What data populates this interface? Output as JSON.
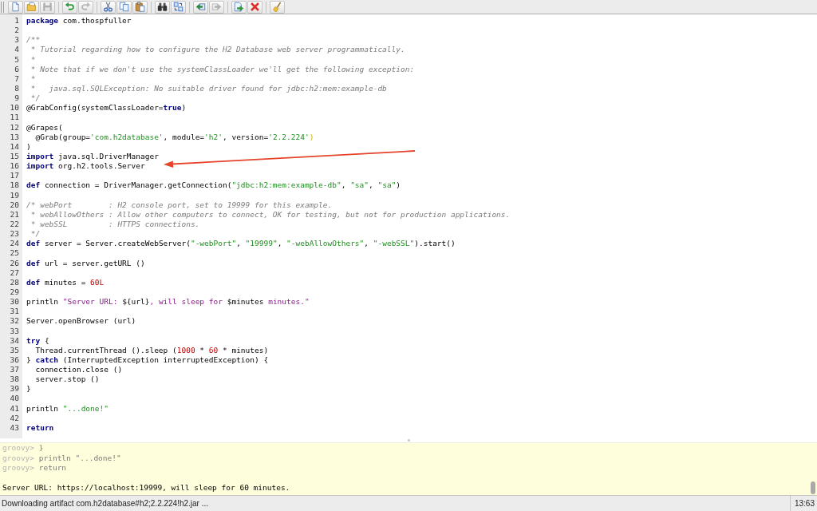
{
  "toolbar": {
    "groups": [
      {
        "buttons": [
          {
            "disabled": false
          },
          {
            "disabled": false
          },
          {
            "disabled": true
          }
        ]
      },
      {
        "buttons": [
          {
            "disabled": false
          },
          {
            "disabled": true
          }
        ]
      },
      {
        "buttons": [
          {
            "disabled": false
          },
          {
            "disabled": false
          },
          {
            "disabled": false
          }
        ]
      },
      {
        "buttons": [
          {
            "disabled": false
          },
          {
            "disabled": false
          }
        ]
      },
      {
        "buttons": [
          {
            "disabled": false
          },
          {
            "disabled": true
          }
        ]
      },
      {
        "buttons": [
          {
            "disabled": false
          },
          {
            "disabled": false
          }
        ]
      },
      {
        "buttons": [
          {
            "disabled": false
          }
        ]
      }
    ]
  },
  "editor": {
    "lines": [
      {
        "number": "1",
        "tokens": [
          {
            "kind": "keyword",
            "text": "package"
          },
          {
            "kind": "plain",
            "text": " com.thospfuller"
          }
        ]
      },
      {
        "number": "2"
      },
      {
        "number": "3",
        "tokens": [
          {
            "kind": "comment",
            "text": "/**"
          }
        ]
      },
      {
        "number": "4",
        "tokens": [
          {
            "kind": "comment",
            "text": " * Tutorial regarding how to configure the H2 Database web server programmatically."
          }
        ]
      },
      {
        "number": "5",
        "tokens": [
          {
            "kind": "comment",
            "text": " *"
          }
        ]
      },
      {
        "number": "6",
        "tokens": [
          {
            "kind": "comment",
            "text": " * Note that if we don't use the systemClassLoader we'll get the following exception:"
          }
        ]
      },
      {
        "number": "7",
        "tokens": [
          {
            "kind": "comment",
            "text": " *"
          }
        ]
      },
      {
        "number": "8",
        "tokens": [
          {
            "kind": "comment",
            "text": " *   java.sql.SQLException: No suitable driver found for jdbc:h2:mem:example-db"
          }
        ]
      },
      {
        "number": "9",
        "tokens": [
          {
            "kind": "comment",
            "text": " */"
          }
        ]
      },
      {
        "number": "10",
        "tokens": [
          {
            "kind": "plain",
            "text": "@GrabConfig(systemClassLoader="
          },
          {
            "kind": "keyword",
            "text": "true"
          },
          {
            "kind": "plain",
            "text": ")"
          }
        ]
      },
      {
        "number": "11"
      },
      {
        "number": "12",
        "tokens": [
          {
            "kind": "plain",
            "text": "@Grapes("
          }
        ]
      },
      {
        "number": "13",
        "tokens": [
          {
            "kind": "plain",
            "text": "  @Grab(group="
          },
          {
            "kind": "string",
            "text": "'com.h2database'"
          },
          {
            "kind": "plain",
            "text": ", module="
          },
          {
            "kind": "string",
            "text": "'h2'"
          },
          {
            "kind": "plain",
            "text": ", version="
          },
          {
            "kind": "string",
            "text": "'2.2.224'"
          },
          {
            "kind": "matched-bracket",
            "text": ")"
          }
        ]
      },
      {
        "number": "14",
        "tokens": [
          {
            "kind": "plain",
            "text": ")"
          }
        ]
      },
      {
        "number": "15",
        "tokens": [
          {
            "kind": "keyword",
            "text": "import"
          },
          {
            "kind": "plain",
            "text": " java.sql.DriverManager"
          }
        ]
      },
      {
        "number": "16",
        "tokens": [
          {
            "kind": "keyword",
            "text": "import"
          },
          {
            "kind": "plain",
            "text": " org.h2.tools.Server"
          }
        ]
      },
      {
        "number": "17"
      },
      {
        "number": "18",
        "tokens": [
          {
            "kind": "keyword",
            "text": "def"
          },
          {
            "kind": "plain",
            "text": " connection = DriverManager.getConnection("
          },
          {
            "kind": "string",
            "text": "\"jdbc:h2:mem:example-db\""
          },
          {
            "kind": "plain",
            "text": ", "
          },
          {
            "kind": "string",
            "text": "\"sa\""
          },
          {
            "kind": "plain",
            "text": ", "
          },
          {
            "kind": "string",
            "text": "\"sa\""
          },
          {
            "kind": "plain",
            "text": ")"
          }
        ]
      },
      {
        "number": "19"
      },
      {
        "number": "20",
        "tokens": [
          {
            "kind": "comment",
            "text": "/* webPort        : H2 console port, set to 19999 for this example."
          }
        ]
      },
      {
        "number": "21",
        "tokens": [
          {
            "kind": "comment",
            "text": " * webAllowOthers : Allow other computers to connect, OK for testing, but not for production applications."
          }
        ]
      },
      {
        "number": "22",
        "tokens": [
          {
            "kind": "comment",
            "text": " * webSSL         : HTTPS connections."
          }
        ]
      },
      {
        "number": "23",
        "tokens": [
          {
            "kind": "comment",
            "text": " */"
          }
        ]
      },
      {
        "number": "24",
        "tokens": [
          {
            "kind": "keyword",
            "text": "def"
          },
          {
            "kind": "plain",
            "text": " server = Server.createWebServer("
          },
          {
            "kind": "string",
            "text": "\"-webPort\""
          },
          {
            "kind": "plain",
            "text": ", "
          },
          {
            "kind": "string",
            "text": "\"19999\""
          },
          {
            "kind": "plain",
            "text": ", "
          },
          {
            "kind": "string",
            "text": "\"-webAllowOthers\""
          },
          {
            "kind": "plain",
            "text": ", "
          },
          {
            "kind": "string",
            "text": "\"-webSSL\""
          },
          {
            "kind": "plain",
            "text": ").start()"
          }
        ]
      },
      {
        "number": "25"
      },
      {
        "number": "26",
        "tokens": [
          {
            "kind": "keyword",
            "text": "def"
          },
          {
            "kind": "plain",
            "text": " url = server.getURL ()"
          }
        ]
      },
      {
        "number": "27"
      },
      {
        "number": "28",
        "tokens": [
          {
            "kind": "keyword",
            "text": "def"
          },
          {
            "kind": "plain",
            "text": " minutes = "
          },
          {
            "kind": "number",
            "text": "60L"
          }
        ]
      },
      {
        "number": "29"
      },
      {
        "number": "30",
        "tokens": [
          {
            "kind": "plain",
            "text": "println "
          },
          {
            "kind": "gstring",
            "text": "\"Server URL: "
          },
          {
            "kind": "plain",
            "text": "${url}"
          },
          {
            "kind": "gstring",
            "text": ", will sleep for "
          },
          {
            "kind": "plain",
            "text": "$minutes"
          },
          {
            "kind": "gstring",
            "text": " minutes.\""
          }
        ]
      },
      {
        "number": "31"
      },
      {
        "number": "32",
        "tokens": [
          {
            "kind": "plain",
            "text": "Server.openBrowser (url)"
          }
        ]
      },
      {
        "number": "33"
      },
      {
        "number": "34",
        "tokens": [
          {
            "kind": "keyword",
            "text": "try"
          },
          {
            "kind": "plain",
            "text": " {"
          }
        ]
      },
      {
        "number": "35",
        "tokens": [
          {
            "kind": "plain",
            "text": "  Thread.currentThread ().sleep ("
          },
          {
            "kind": "number",
            "text": "1000"
          },
          {
            "kind": "plain",
            "text": " * "
          },
          {
            "kind": "number",
            "text": "60"
          },
          {
            "kind": "plain",
            "text": " * minutes)"
          }
        ]
      },
      {
        "number": "36",
        "tokens": [
          {
            "kind": "plain",
            "text": "} "
          },
          {
            "kind": "keyword",
            "text": "catch"
          },
          {
            "kind": "plain",
            "text": " (InterruptedException interruptedException) {"
          }
        ]
      },
      {
        "number": "37",
        "tokens": [
          {
            "kind": "plain",
            "text": "  connection.close ()"
          }
        ]
      },
      {
        "number": "38",
        "tokens": [
          {
            "kind": "plain",
            "text": "  server.stop ()"
          }
        ]
      },
      {
        "number": "39",
        "tokens": [
          {
            "kind": "plain",
            "text": "}"
          }
        ]
      },
      {
        "number": "40"
      },
      {
        "number": "41",
        "tokens": [
          {
            "kind": "plain",
            "text": "println "
          },
          {
            "kind": "string",
            "text": "\"...done!\""
          }
        ]
      },
      {
        "number": "42"
      },
      {
        "number": "43",
        "tokens": [
          {
            "kind": "keyword",
            "text": "return"
          }
        ]
      }
    ]
  },
  "output": {
    "lines": [
      {
        "kind": "input",
        "prompt": "groovy>",
        "text": " }"
      },
      {
        "kind": "input",
        "prompt": "groovy>",
        "text": " println \"...done!\""
      },
      {
        "kind": "input",
        "prompt": "groovy>",
        "text": " return"
      },
      {
        "kind": "blank"
      },
      {
        "kind": "result",
        "text": "Server URL: https://localhost:19999, will sleep for 60 minutes."
      }
    ]
  },
  "status_bar": {
    "message": "Downloading artifact com.h2database#h2;2.2.224!h2.jar ...",
    "position": "13:63"
  }
}
